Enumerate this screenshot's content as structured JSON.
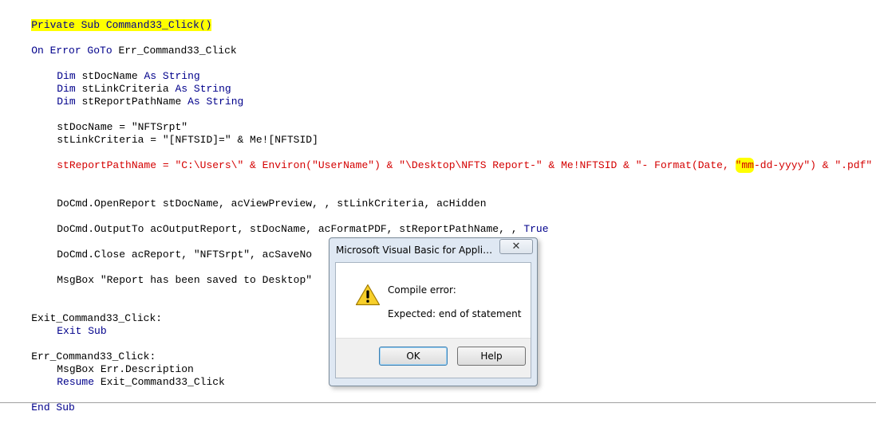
{
  "code": {
    "l1": "Private Sub Command33_Click()",
    "l2_kw": "On Error GoTo",
    "l2_rest": " Err_Command33_Click",
    "dim_kw": "Dim",
    "as_kw": "As",
    "string_kw": "String",
    "l3_name": "stDocName",
    "l4_name": "stLinkCriteria",
    "l5_name": "stReportPathName",
    "l6": "stDocName = \"NFTSrpt\"",
    "l7": "stLinkCriteria = \"[NFTSID]=\" & Me![NFTSID]",
    "l8_a": "stReportPathName = \"C:\\Users\\\" & Environ(\"UserName\") & \"\\Desktop\\NFTS Report-\" & Me!NFTSID & \"- Format(Date, ",
    "l8_b": "\"mm",
    "l8_c": "-dd-yyyy\") & \".pdf\"",
    "l9": "DoCmd.OpenReport stDocName, acViewPreview, , stLinkCriteria, acHidden",
    "l10_a": "DoCmd.OutputTo acOutputReport, stDocName, acFormatPDF, stReportPathName, , ",
    "l10_kw": "True",
    "l11": "DoCmd.Close acReport, \"NFTSrpt\", acSaveNo",
    "l12": "MsgBox \"Report has been saved to Desktop\"",
    "l13": "Exit_Command33_Click:",
    "l14": "Exit Sub",
    "l15": "Err_Command33_Click:",
    "l16": "MsgBox Err.Description",
    "l17_kw": "Resume",
    "l17_rest": " Exit_Command33_Click",
    "l18": "End Sub"
  },
  "dialog": {
    "title": "Microsoft Visual Basic for Applicatio...",
    "close_glyph": "✕",
    "heading": "Compile error:",
    "message": "Expected: end of statement",
    "ok_label": "OK",
    "help_label": "Help",
    "icon": "warning-icon"
  },
  "colors": {
    "keyword": "#00008b",
    "error_line": "#d40000",
    "highlight": "#ffff00"
  }
}
